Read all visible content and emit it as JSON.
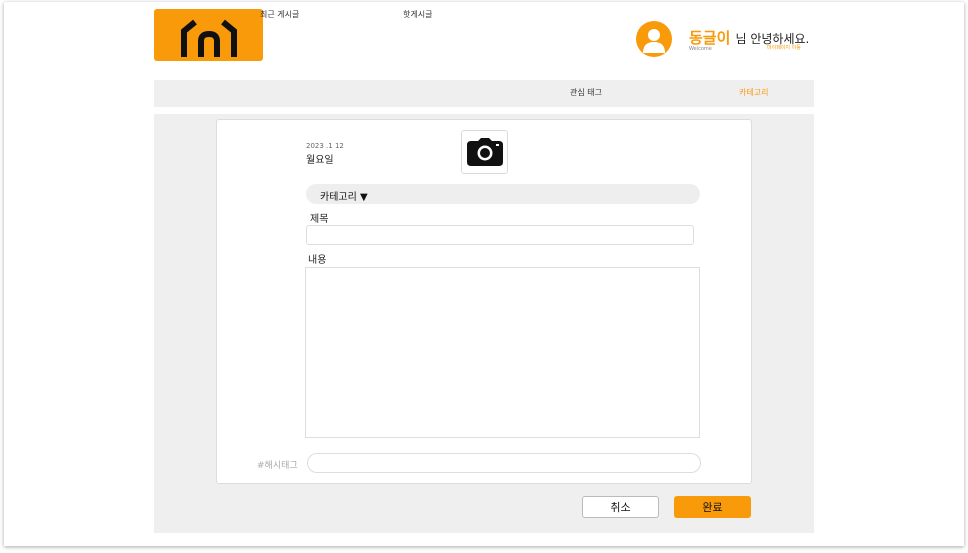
{
  "header": {
    "user_name": "동글이",
    "greeting_suffix": "님 안녕하세요.",
    "welcome_text": "Welcome",
    "mypage_link": "마이페이지 이동"
  },
  "nav": {
    "items": [
      {
        "label": "최근 게시글"
      },
      {
        "label": "핫게시글"
      },
      {
        "label": "관심 태그"
      },
      {
        "label": "카테고리"
      }
    ],
    "active_index": 3
  },
  "form": {
    "date": "2023 .1 12",
    "weekday": "월요일",
    "category_label": "카테고리 ▼",
    "title_label": "제목",
    "title_value": "",
    "content_label": "내용",
    "content_value": "",
    "hashtag_label": "#해시태그",
    "hashtag_value": ""
  },
  "buttons": {
    "cancel": "취소",
    "done": "완료"
  },
  "colors": {
    "accent": "#f99a0a",
    "panel": "#efefef",
    "border": "#dddddd"
  },
  "icons": {
    "logo": "house-logo-icon",
    "avatar": "user-avatar-icon",
    "photo": "camera-icon"
  }
}
